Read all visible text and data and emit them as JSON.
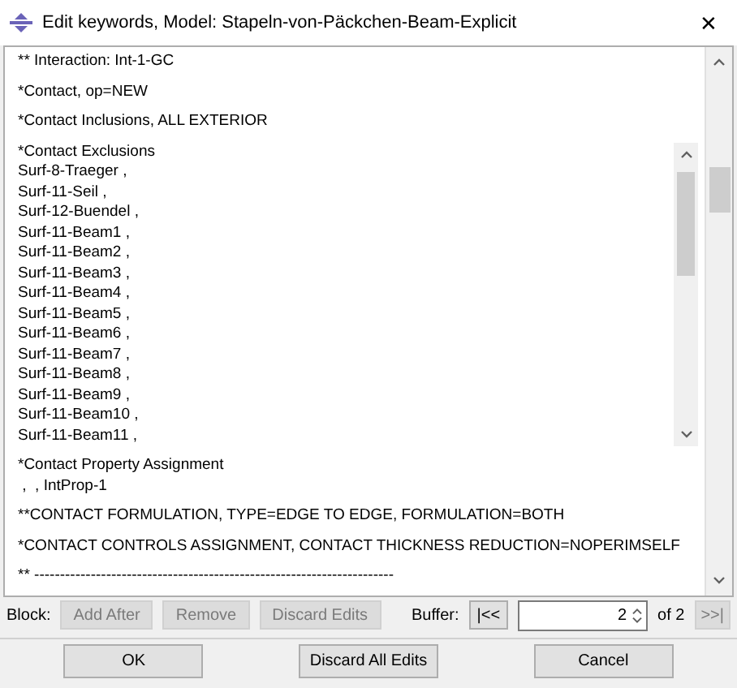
{
  "window": {
    "title": "Edit keywords, Model: Stapeln-von-Päckchen-Beam-Explicit",
    "close": "✕"
  },
  "blocks": [
    {
      "kind": "plain",
      "lines": [
        "** Interaction: Int-1-GC"
      ]
    },
    {
      "kind": "plain",
      "lines": [
        "*Contact, op=NEW"
      ]
    },
    {
      "kind": "plain",
      "lines": [
        "*Contact Inclusions, ALL EXTERIOR"
      ]
    },
    {
      "kind": "scroll",
      "lines": [
        "*Contact Exclusions",
        "Surf-8-Traeger ,",
        "Surf-11-Seil ,",
        "Surf-12-Buendel ,",
        "Surf-11-Beam1 ,",
        "Surf-11-Beam2 ,",
        "Surf-11-Beam3 ,",
        "Surf-11-Beam4 ,",
        "Surf-11-Beam5 ,",
        "Surf-11-Beam6 ,",
        "Surf-11-Beam7 ,",
        "Surf-11-Beam8 ,",
        "Surf-11-Beam9 ,",
        "Surf-11-Beam10 ,",
        "Surf-11-Beam11 ,"
      ]
    },
    {
      "kind": "plain",
      "lines": [
        "*Contact Property Assignment",
        " ,  , IntProp-1"
      ]
    },
    {
      "kind": "plain",
      "lines": [
        "**CONTACT FORMULATION, TYPE=EDGE TO EDGE, FORMULATION=BOTH"
      ]
    },
    {
      "kind": "plain",
      "lines": [
        "*CONTACT CONTROLS ASSIGNMENT, CONTACT THICKNESS REDUCTION=NOPERIMSELF"
      ]
    },
    {
      "kind": "plain",
      "lines": [
        "** ----------------------------------------------------------------------"
      ]
    }
  ],
  "block_bar": {
    "label": "Block:",
    "buttons": [
      {
        "label": "Add After",
        "disabled": true
      },
      {
        "label": "Remove",
        "disabled": true
      },
      {
        "label": "Discard Edits",
        "disabled": true
      }
    ]
  },
  "buffer": {
    "label": "Buffer:",
    "first": {
      "label": "|<<",
      "disabled": false
    },
    "value": "2",
    "of": "of 2",
    "last": {
      "label": ">>|",
      "disabled": true
    }
  },
  "buttons": [
    {
      "label": "OK"
    },
    {
      "label": "Discard All Edits"
    },
    {
      "label": "Cancel"
    }
  ]
}
